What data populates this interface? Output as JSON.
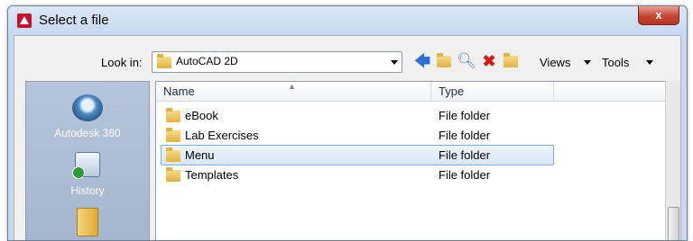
{
  "window": {
    "title": "Select a file",
    "close_label": "x"
  },
  "toolbar": {
    "lookin_label": "Look in:",
    "lookin_value": "AutoCAD 2D",
    "icons": [
      "back-arrow-icon",
      "up-folder-icon",
      "search-web-icon",
      "delete-icon",
      "create-folder-icon"
    ],
    "views_label": "Views",
    "tools_label": "Tools"
  },
  "places": [
    {
      "label": "Autodesk 360",
      "icon": "autodesk-360-icon"
    },
    {
      "label": "History",
      "icon": "history-icon"
    },
    {
      "label": "",
      "icon": "documents-folder-icon"
    }
  ],
  "columns": {
    "name": "Name",
    "type": "Type"
  },
  "files": [
    {
      "name": "eBook",
      "type": "File folder",
      "selected": false
    },
    {
      "name": "Lab Exercises",
      "type": "File folder",
      "selected": false
    },
    {
      "name": "Menu",
      "type": "File folder",
      "selected": true
    },
    {
      "name": "Templates",
      "type": "File folder",
      "selected": false
    }
  ],
  "colors": {
    "accent": "#c8102e",
    "selection": "#d7e7f8",
    "places_panel": "#a4b6cc"
  }
}
